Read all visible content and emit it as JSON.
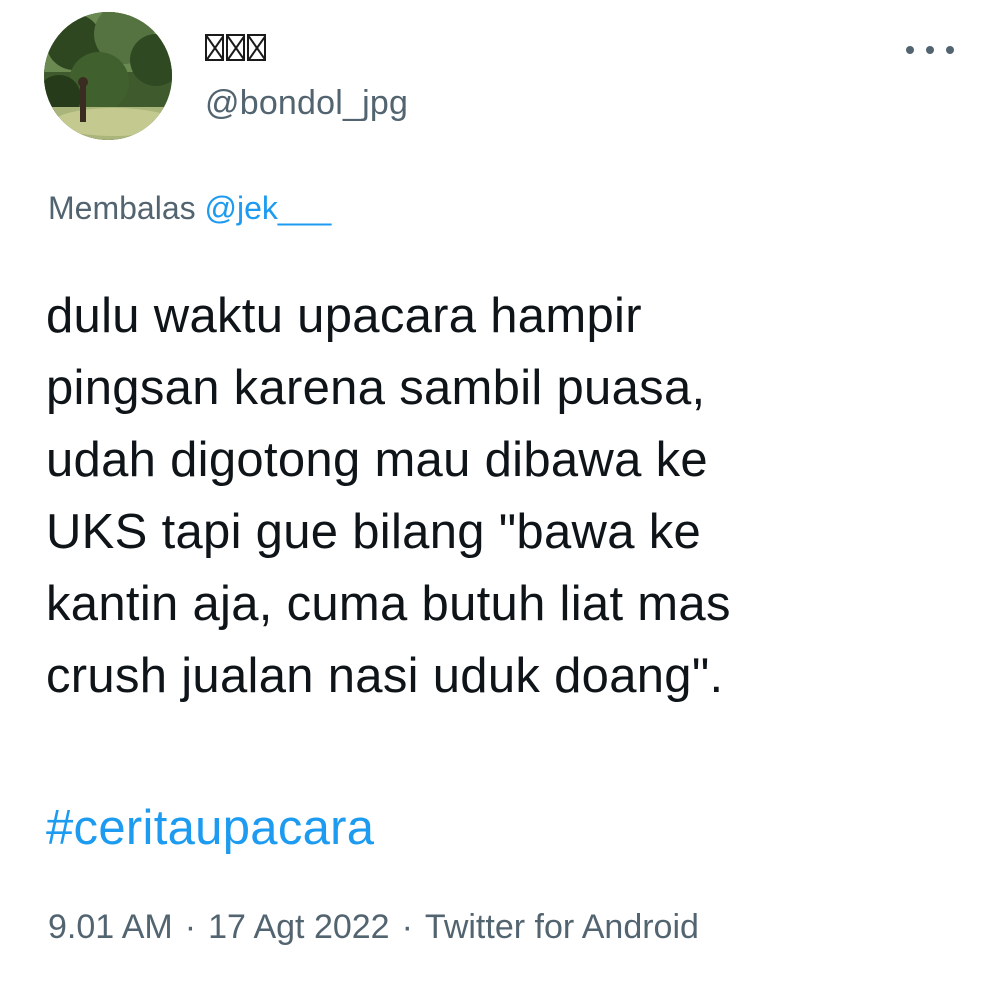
{
  "author": {
    "display_name_glyphs": [
      "unrenderable-glyph",
      "unrenderable-glyph",
      "unrenderable-glyph"
    ],
    "handle": "@bondol_jpg",
    "avatar_icon": "avatar-photo-forest"
  },
  "more_icon": "more-horizontal-icon",
  "reply": {
    "prefix": "Membalas",
    "mention": "@jek___"
  },
  "tweet": {
    "text": "dulu waktu upacara hampir\npingsan karena sambil puasa,\nudah digotong mau dibawa ke\nUKS tapi gue bilang \"bawa ke\nkantin aja, cuma butuh liat mas\ncrush jualan nasi uduk doang\".",
    "hashtag": "#ceritaupacara"
  },
  "meta": {
    "time": "9.01 AM",
    "separator": "·",
    "date": "17 Agt 2022",
    "source": "Twitter for Android"
  },
  "colors": {
    "text": "#0f1419",
    "secondary": "#536471",
    "link": "#1d9bf0"
  }
}
